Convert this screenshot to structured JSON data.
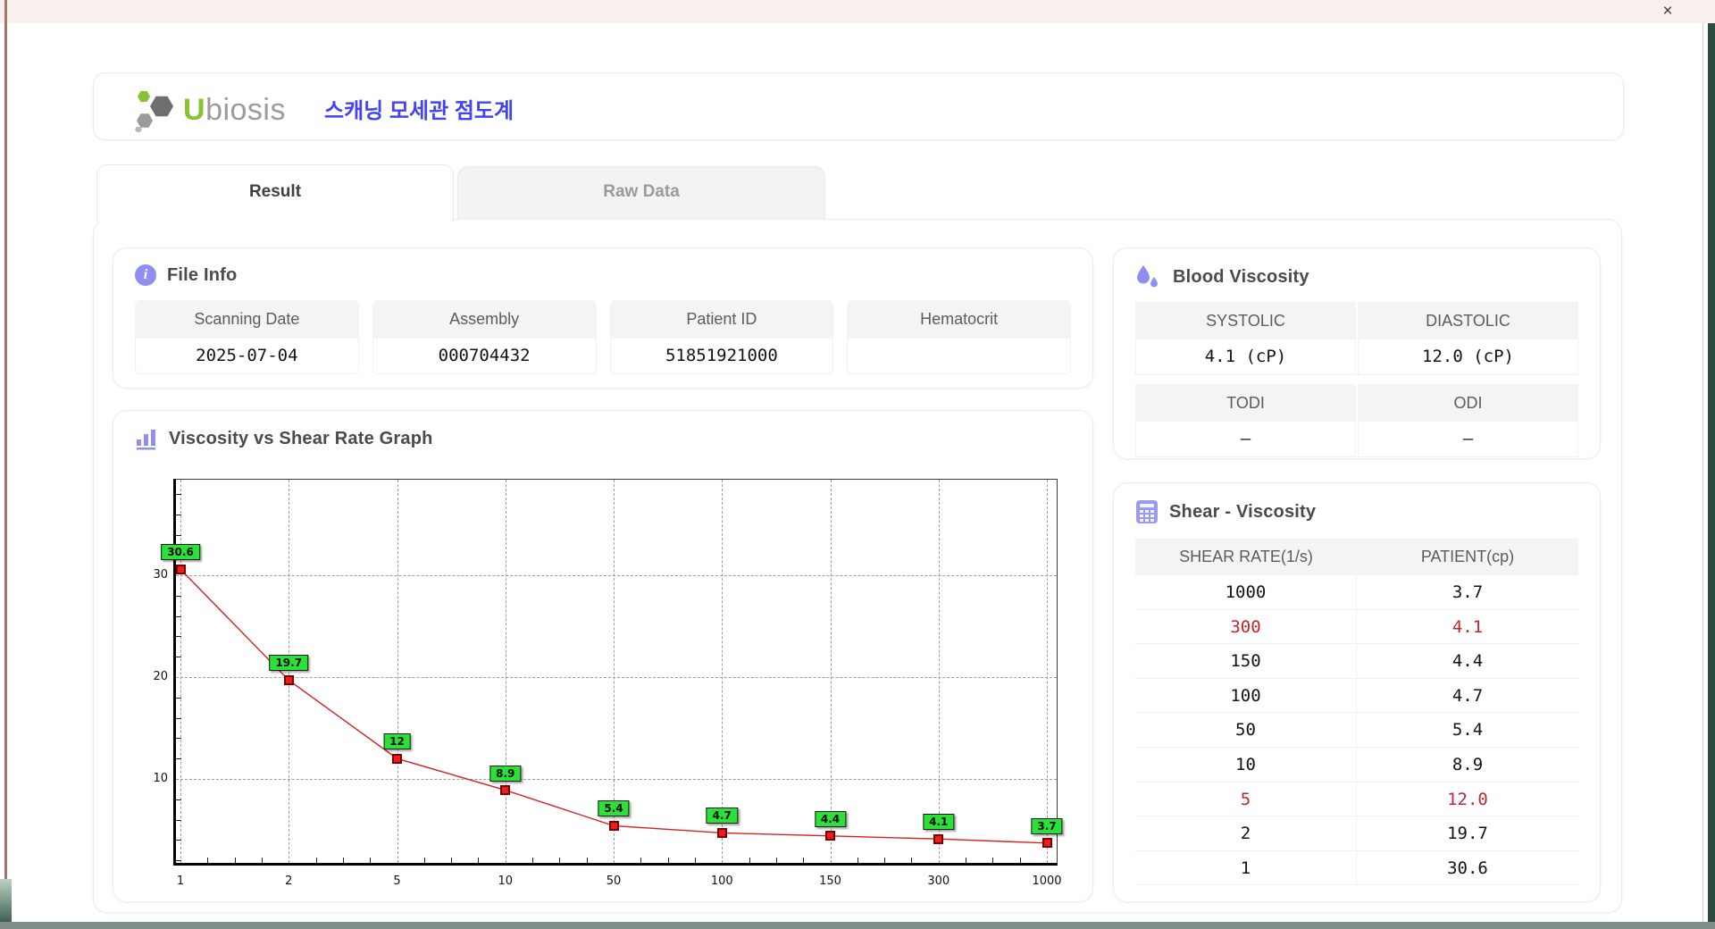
{
  "window": {
    "close_label": "×"
  },
  "header": {
    "logo_first_letter": "U",
    "logo_rest": "biosis",
    "app_title": "스캐닝 모세관 점도계"
  },
  "tabs": [
    {
      "label": "Result",
      "active": true
    },
    {
      "label": "Raw Data",
      "active": false
    }
  ],
  "file_info": {
    "title": "File Info",
    "fields": [
      {
        "label": "Scanning Date",
        "value": "2025-07-04"
      },
      {
        "label": "Assembly",
        "value": "000704432"
      },
      {
        "label": "Patient ID",
        "value": "51851921000"
      },
      {
        "label": "Hematocrit",
        "value": ""
      }
    ]
  },
  "graph": {
    "title": "Viscosity vs Shear Rate Graph"
  },
  "chart_data": {
    "type": "line",
    "title": "Viscosity vs Shear Rate Graph",
    "x_categories": [
      1,
      2,
      5,
      10,
      50,
      100,
      150,
      300,
      1000
    ],
    "series": [
      {
        "name": "PATIENT",
        "values": [
          30.6,
          19.7,
          12,
          8.9,
          5.4,
          4.7,
          4.4,
          4.1,
          3.7
        ]
      }
    ],
    "point_labels": [
      "30.6",
      "19.7",
      "12",
      "8.9",
      "5.4",
      "4.7",
      "4.4",
      "4.1",
      "3.7"
    ],
    "yticks": [
      10,
      20,
      30
    ],
    "ylim": [
      1.4,
      39.4
    ],
    "xlabel": "",
    "ylabel": "",
    "grid": "dashed",
    "legend": "none",
    "line_color": "#d42222",
    "marker_color": "#ee1c1c",
    "point_label_bg": "#2be036"
  },
  "blood_viscosity": {
    "title": "Blood Viscosity",
    "row1": [
      {
        "label": "SYSTOLIC",
        "value": "4.1 (cP)"
      },
      {
        "label": "DIASTOLIC",
        "value": "12.0 (cP)"
      }
    ],
    "row2": [
      {
        "label": "TODI",
        "value": "–"
      },
      {
        "label": "ODI",
        "value": "–"
      }
    ]
  },
  "shear_viscosity": {
    "title": "Shear - Viscosity",
    "columns": [
      "SHEAR RATE(1/s)",
      "PATIENT(cp)"
    ],
    "rows": [
      {
        "rate": "1000",
        "value": "3.7",
        "highlight": false
      },
      {
        "rate": "300",
        "value": "4.1",
        "highlight": true
      },
      {
        "rate": "150",
        "value": "4.4",
        "highlight": false
      },
      {
        "rate": "100",
        "value": "4.7",
        "highlight": false
      },
      {
        "rate": "50",
        "value": "5.4",
        "highlight": false
      },
      {
        "rate": "10",
        "value": "8.9",
        "highlight": false
      },
      {
        "rate": "5",
        "value": "12.0",
        "highlight": true
      },
      {
        "rate": "2",
        "value": "19.7",
        "highlight": false
      },
      {
        "rate": "1",
        "value": "30.6",
        "highlight": false
      }
    ],
    "highlight_color": "#c1272d"
  },
  "colors": {
    "accent_purple": "#8f8ff2",
    "title_blue": "#4343f2",
    "logo_green": "#85c42e",
    "card_border": "#ececec",
    "cell_header_bg": "#f4f4f4"
  }
}
